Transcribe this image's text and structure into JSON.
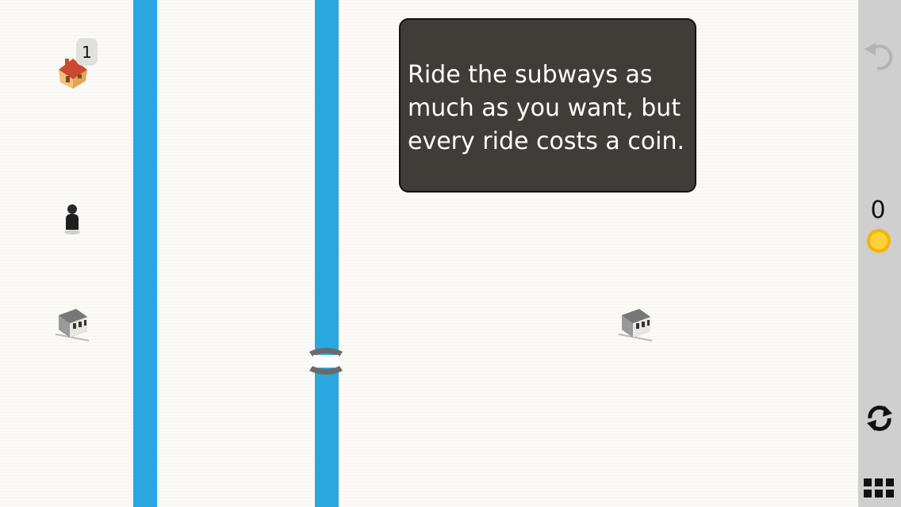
{
  "tooltip": {
    "text": "Ride the subways as much as you want, but every ride costs a coin."
  },
  "house": {
    "icon": "house-icon",
    "badge_count": "1"
  },
  "hud": {
    "coins": "0"
  },
  "icons": {
    "person": "person-icon",
    "car": "subway-car-icon",
    "bridge": "subway-bridge-icon",
    "undo": "undo-icon",
    "coin": "coin-icon",
    "restart": "restart-icon",
    "menu": "grid-menu-icon"
  },
  "colors": {
    "river": "#29a8e0",
    "tooltip_bg": "#403d39",
    "sidebar": "#cfcfcf",
    "coin": "#f5b400"
  }
}
